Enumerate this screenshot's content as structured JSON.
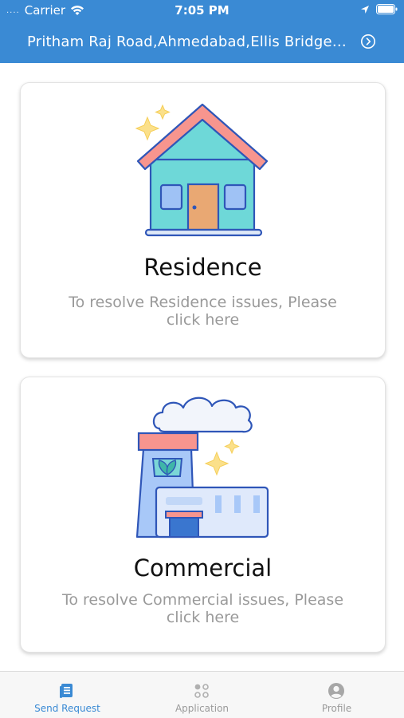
{
  "status_bar": {
    "carrier": "Carrier",
    "time": "7:05 PM",
    "signal_dots": "....",
    "wifi_icon": "wifi-icon",
    "location_icon": "location-arrow-icon",
    "battery_icon": "battery-icon"
  },
  "header": {
    "address": "Pritham Raj Road,Ahmedabad,Ellis Bridge,I...",
    "chevron_icon": "chevron-right-circle-icon",
    "background_color": "#3a8ad4"
  },
  "cards": [
    {
      "title": "Residence",
      "description": "To resolve Residence issues, Please click here",
      "icon": "house-icon"
    },
    {
      "title": "Commercial",
      "description": "To resolve Commercial issues, Please click here",
      "icon": "factory-icon"
    }
  ],
  "tabbar": {
    "tabs": [
      {
        "label": "Send Request",
        "icon": "document-list-icon",
        "active": true
      },
      {
        "label": "Application",
        "icon": "grid-dots-icon",
        "active": false
      },
      {
        "label": "Profile",
        "icon": "user-circle-icon",
        "active": false
      }
    ],
    "active_color": "#3a8ad4",
    "inactive_color": "#9a9a9a"
  }
}
